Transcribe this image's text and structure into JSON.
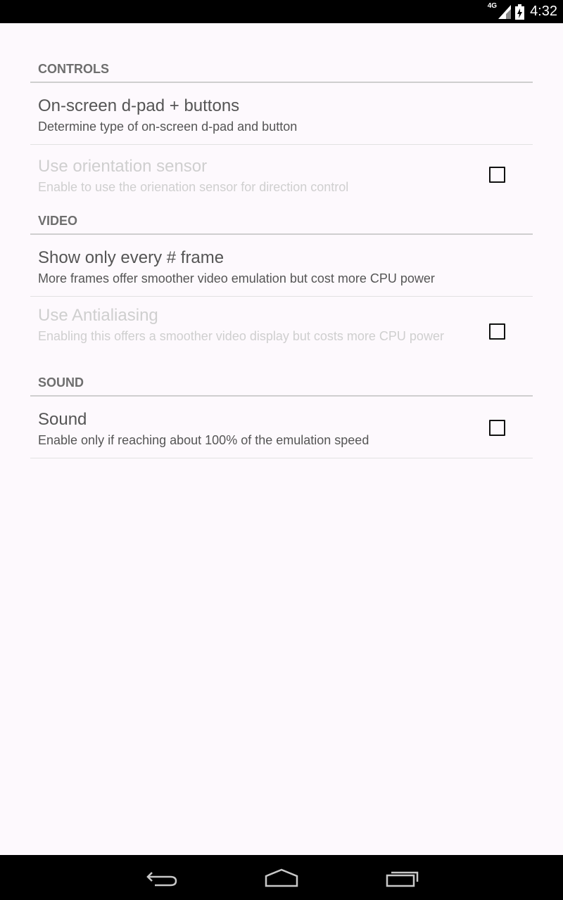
{
  "status_bar": {
    "network": "4G",
    "time": "4:32",
    "icons": [
      "signal-icon",
      "battery-icon"
    ]
  },
  "sections": [
    {
      "header": "CONTROLS",
      "items": [
        {
          "title": "On-screen d-pad + buttons",
          "summary": "Determine type of on-screen d-pad and button",
          "enabled": true
        },
        {
          "title": "Use orientation sensor",
          "summary": "Enable to use the orienation sensor for direction control",
          "enabled": false,
          "checkbox": false
        }
      ]
    },
    {
      "header": "VIDEO",
      "items": [
        {
          "title": "Show only every # frame",
          "summary": "More frames offer smoother video emulation but cost more CPU power",
          "enabled": true
        },
        {
          "title": "Use Antialiasing",
          "summary": "Enabling this offers a smoother video display but costs more CPU power",
          "enabled": false,
          "checkbox": false
        }
      ]
    },
    {
      "header": "SOUND",
      "items": [
        {
          "title": "Sound",
          "summary": "Enable only if reaching about 100% of the emulation speed",
          "enabled": true,
          "checkbox": false
        }
      ]
    }
  ],
  "nav_bar": {
    "icons": [
      "back-icon",
      "home-icon",
      "recents-icon"
    ]
  }
}
